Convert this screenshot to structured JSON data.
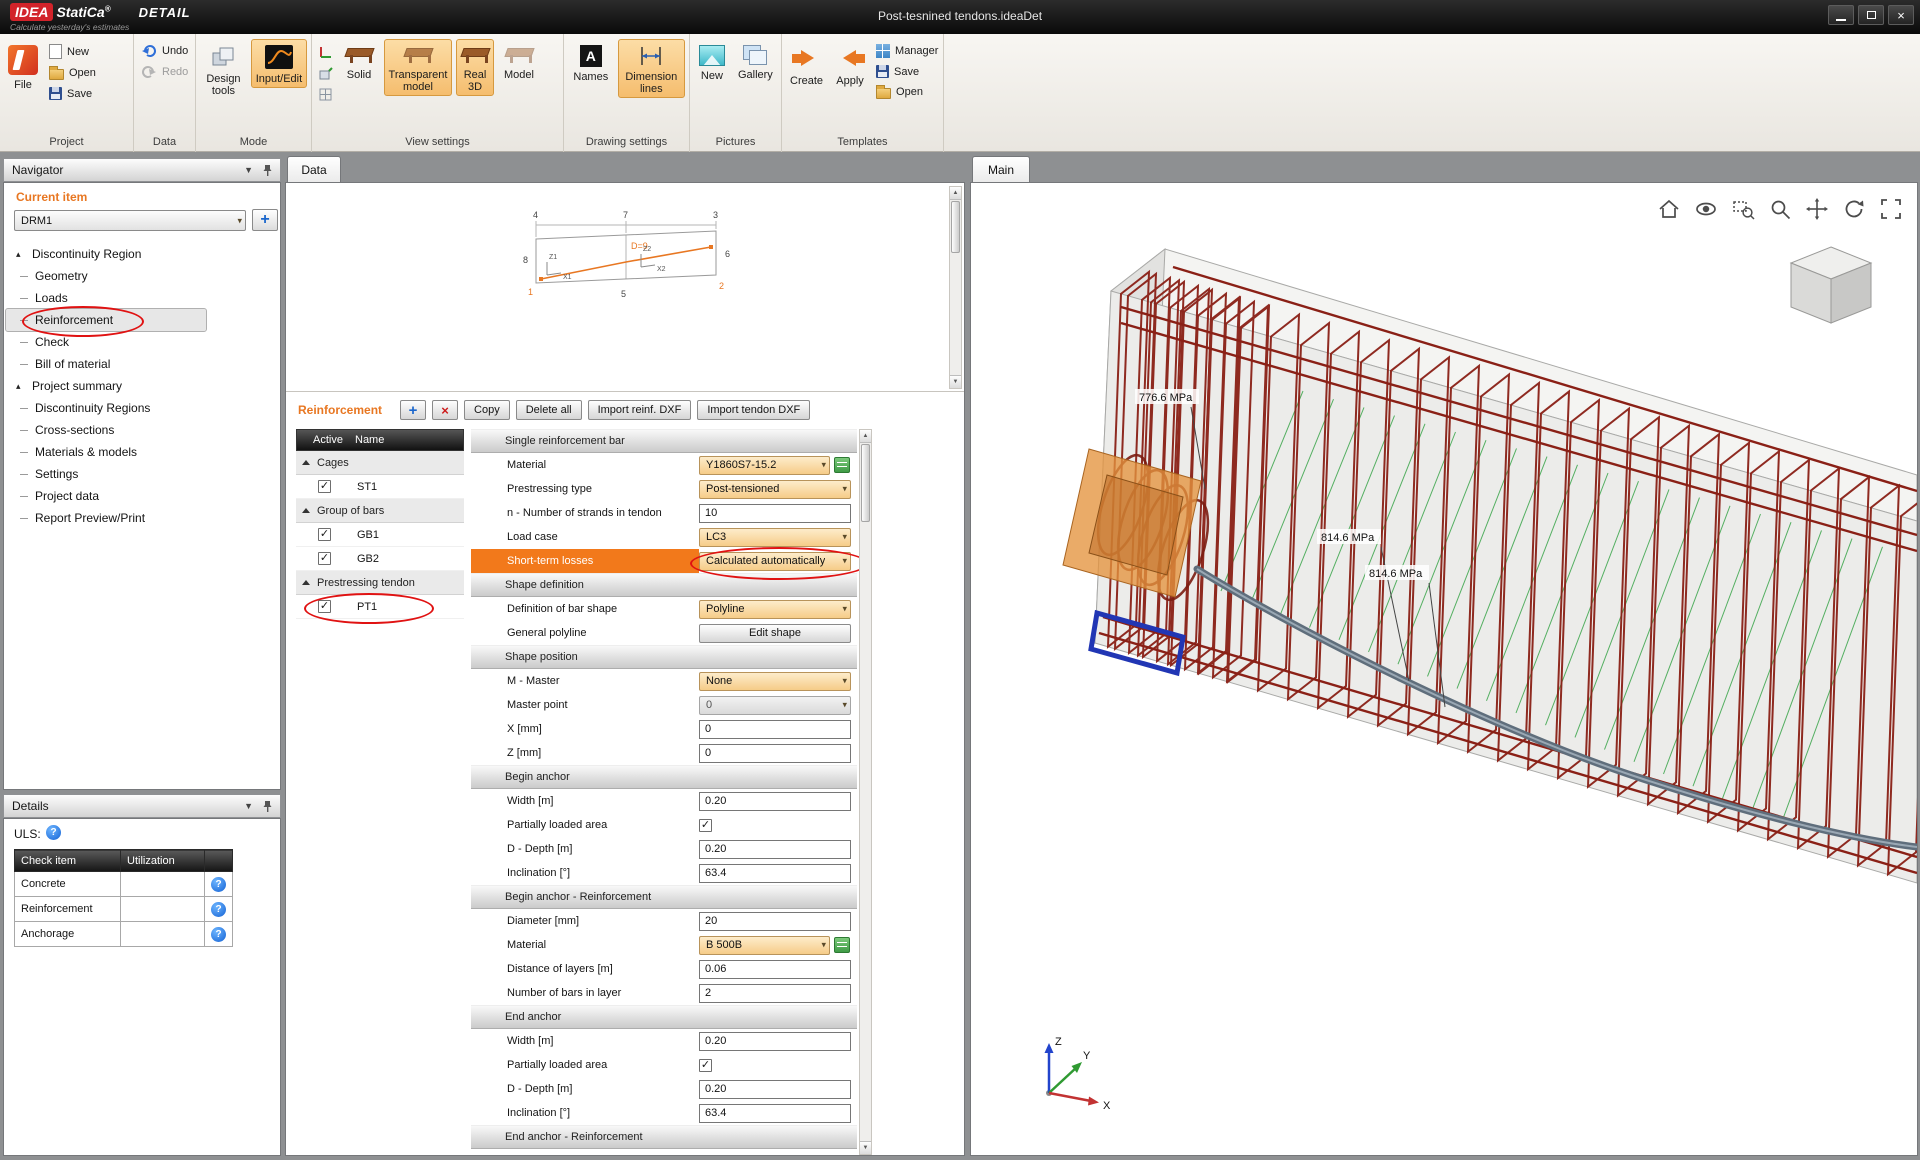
{
  "titlebar": {
    "logo_primary": "IDEA",
    "logo_secondary": "StatiCa",
    "logo_registered": "®",
    "logo_module": "DETAIL",
    "tagline": "Calculate yesterday's estimates",
    "document_title": "Post-tesnined tendons.ideaDet"
  },
  "ribbon": {
    "project": {
      "label": "Project",
      "file": "File",
      "new": "New",
      "open": "Open",
      "save": "Save"
    },
    "data": {
      "label": "Data",
      "undo": "Undo",
      "redo": "Redo"
    },
    "mode": {
      "label": "Mode",
      "design_tools": "Design tools",
      "input_edit": "Input/Edit"
    },
    "view_settings": {
      "label": "View settings",
      "solid": "Solid",
      "transparent_model": "Transparent model",
      "real_3d": "Real 3D",
      "model": "Model"
    },
    "drawing_settings": {
      "label": "Drawing settings",
      "names": "Names",
      "dimension_lines": "Dimension lines"
    },
    "pictures": {
      "label": "Pictures",
      "new": "New",
      "gallery": "Gallery"
    },
    "templates": {
      "label": "Templates",
      "create": "Create",
      "apply": "Apply",
      "manager": "Manager",
      "save": "Save",
      "open": "Open"
    }
  },
  "navigator": {
    "title": "Navigator",
    "current_item_label": "Current item",
    "current_item_value": "DRM1",
    "tree": [
      {
        "label": "Discontinuity Region",
        "group": true
      },
      {
        "label": "Geometry"
      },
      {
        "label": "Loads"
      },
      {
        "label": "Reinforcement",
        "selected": true,
        "annotated": true
      },
      {
        "label": "Check"
      },
      {
        "label": "Bill of material"
      },
      {
        "label": "Project summary",
        "group": true
      },
      {
        "label": "Discontinuity Regions"
      },
      {
        "label": "Cross-sections"
      },
      {
        "label": "Materials & models"
      },
      {
        "label": "Settings"
      },
      {
        "label": "Project data"
      },
      {
        "label": "Report Preview/Print"
      }
    ]
  },
  "details": {
    "title": "Details",
    "uls_label": "ULS:",
    "table": {
      "col_check_item": "Check item",
      "col_utilization": "Utilization",
      "rows": [
        "Concrete",
        "Reinforcement",
        "Anchorage"
      ]
    }
  },
  "data_panel": {
    "tab": "Data",
    "diagram": {
      "dim_top_left": "4",
      "dim_top_mid": "7",
      "dim_top_right": "3",
      "dim_left": "8",
      "dim_right": "6",
      "dim_center": "D=9",
      "dim_bottom": "5",
      "node_left": "1",
      "node_right": "2",
      "axis_z1": "Z1",
      "axis_x1": "X1",
      "axis_z2": "Z2",
      "axis_x2": "X2"
    },
    "reinforcement": {
      "title": "Reinforcement",
      "copy": "Copy",
      "delete_all": "Delete all",
      "import_reinf": "Import reinf. DXF",
      "import_tendon": "Import tendon DXF",
      "col_active": "Active",
      "col_name": "Name",
      "groups": [
        {
          "label": "Cages",
          "items": [
            {
              "name": "ST1",
              "active": true
            }
          ]
        },
        {
          "label": "Group of bars",
          "items": [
            {
              "name": "GB1",
              "active": true
            },
            {
              "name": "GB2",
              "active": true
            }
          ]
        },
        {
          "label": "Prestressing tendon",
          "items": [
            {
              "name": "PT1",
              "active": true,
              "annotated": true
            }
          ]
        }
      ]
    }
  },
  "properties": {
    "sections": [
      {
        "title": "Single reinforcement bar",
        "rows": [
          {
            "label": "Material",
            "value": "Y1860S7-15.2",
            "control": "dropdown",
            "extra": "material-editor"
          },
          {
            "label": "Prestressing type",
            "value": "Post-tensioned",
            "control": "dropdown"
          },
          {
            "label": "n - Number of strands in tendon",
            "value": "10",
            "control": "input"
          },
          {
            "label": "Load case",
            "value": "LC3",
            "control": "dropdown"
          },
          {
            "label": "Short-term losses",
            "value": "Calculated automatically",
            "control": "dropdown",
            "highlighted": true,
            "annotated": true
          }
        ]
      },
      {
        "title": "Shape definition",
        "rows": [
          {
            "label": "Definition of bar shape",
            "value": "Polyline",
            "control": "dropdown"
          },
          {
            "label": "General polyline",
            "value": "Edit shape",
            "control": "button"
          }
        ]
      },
      {
        "title": "Shape position",
        "rows": [
          {
            "label": "M - Master",
            "value": "None",
            "control": "dropdown"
          },
          {
            "label": "Master point",
            "value": "0",
            "control": "dropdown_disabled"
          },
          {
            "label": "X [mm]",
            "value": "0",
            "control": "input"
          },
          {
            "label": "Z [mm]",
            "value": "0",
            "control": "input"
          }
        ]
      },
      {
        "title": "Begin anchor",
        "rows": [
          {
            "label": "Width [m]",
            "value": "0.20",
            "control": "input"
          },
          {
            "label": "Partially loaded area",
            "checked": true,
            "control": "checkbox"
          },
          {
            "label": "D - Depth [m]",
            "value": "0.20",
            "control": "input"
          },
          {
            "label": "Inclination [°]",
            "value": "63.4",
            "control": "input"
          }
        ]
      },
      {
        "title": "Begin anchor - Reinforcement",
        "rows": [
          {
            "label": "Diameter [mm]",
            "value": "20",
            "control": "input"
          },
          {
            "label": "Material",
            "value": "B 500B",
            "control": "dropdown",
            "extra": "material-editor"
          },
          {
            "label": "Distance of layers [m]",
            "value": "0.06",
            "control": "input"
          },
          {
            "label": "Number of bars in layer",
            "value": "2",
            "control": "input"
          }
        ]
      },
      {
        "title": "End anchor",
        "rows": [
          {
            "label": "Width [m]",
            "value": "0.20",
            "control": "input"
          },
          {
            "label": "Partially loaded area",
            "checked": true,
            "control": "checkbox"
          },
          {
            "label": "D - Depth [m]",
            "value": "0.20",
            "control": "input"
          },
          {
            "label": "Inclination [°]",
            "value": "63.4",
            "control": "input"
          }
        ]
      },
      {
        "title": "End anchor - Reinforcement",
        "rows": []
      }
    ]
  },
  "main_view": {
    "tab": "Main",
    "stress_labels": [
      "776.6 MPa",
      "814.6 MPa",
      "814.6 MPa"
    ],
    "axis_x": "X",
    "axis_y": "Y",
    "axis_z": "Z",
    "toolbar_icons": [
      "home-icon",
      "visibility-icon",
      "zoom-window-icon",
      "zoom-icon",
      "pan-icon",
      "rotate-icon",
      "fit-view-icon"
    ]
  }
}
